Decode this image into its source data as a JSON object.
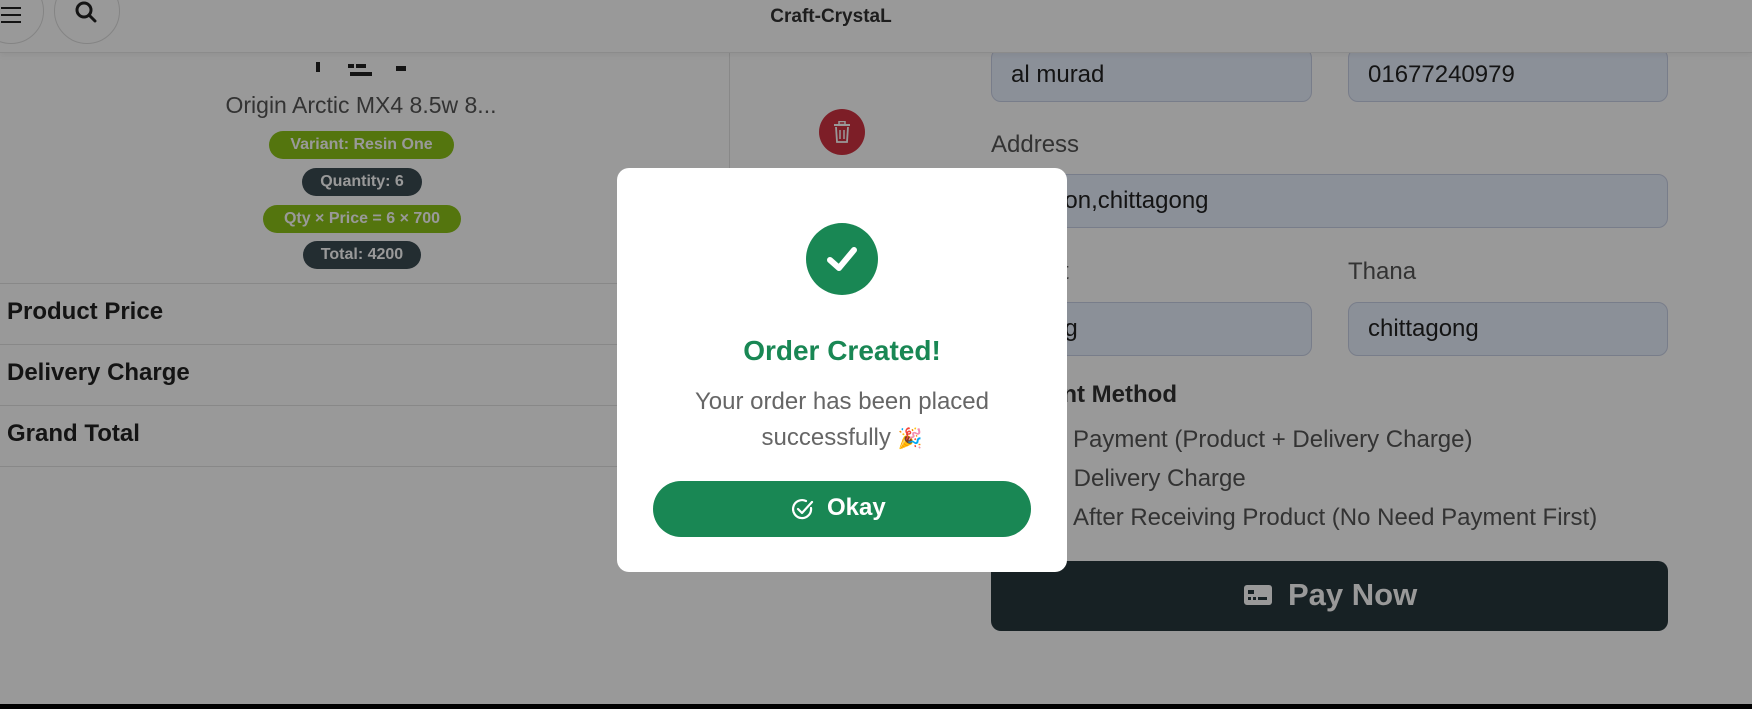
{
  "header": {
    "brand": "Craft-CrystaL",
    "menu_icon": "hamburger-menu-icon",
    "search_icon": "search-icon"
  },
  "cart_item": {
    "name": "Origin Arctic MX4 8.5w 8...",
    "variant": "Variant: Resin One",
    "quantity": "Quantity: 6",
    "qty_price": "Qty × Price = 6 × 700",
    "total": "Total: 4200",
    "delete_icon": "trash-icon"
  },
  "summary": {
    "rows": [
      {
        "label": "Product Price"
      },
      {
        "label": "Delivery Charge"
      },
      {
        "label": "Grand Total"
      }
    ]
  },
  "form": {
    "name_value": "al murad",
    "phone_value": "01677240979",
    "address_label": "Address",
    "address_value": "adgaon,chittagong",
    "district_label": "t",
    "district_value": "agong",
    "thana_label": "Thana",
    "thana_value": "chittagong",
    "payment_method_title": "ent Method",
    "payment_options": [
      "Payment (Product + Delivery Charge)",
      "y Delivery Charge",
      "After Receiving Product (No Need Payment First)"
    ],
    "pay_now_label": "Pay Now",
    "pay_icon": "payment-card-icon"
  },
  "modal": {
    "icon": "check-circle-icon",
    "title": "Order Created!",
    "message": "Your order has been placed successfully",
    "emoji": "🎉",
    "okay_label": "Okay",
    "okay_icon": "check-badge-icon"
  },
  "colors": {
    "success": "#198754",
    "danger": "#d13342",
    "pill_green": "#8cc418",
    "pill_dark": "#3b4b53",
    "pay_button": "#27373d",
    "input_bg": "#e8f0fe"
  }
}
